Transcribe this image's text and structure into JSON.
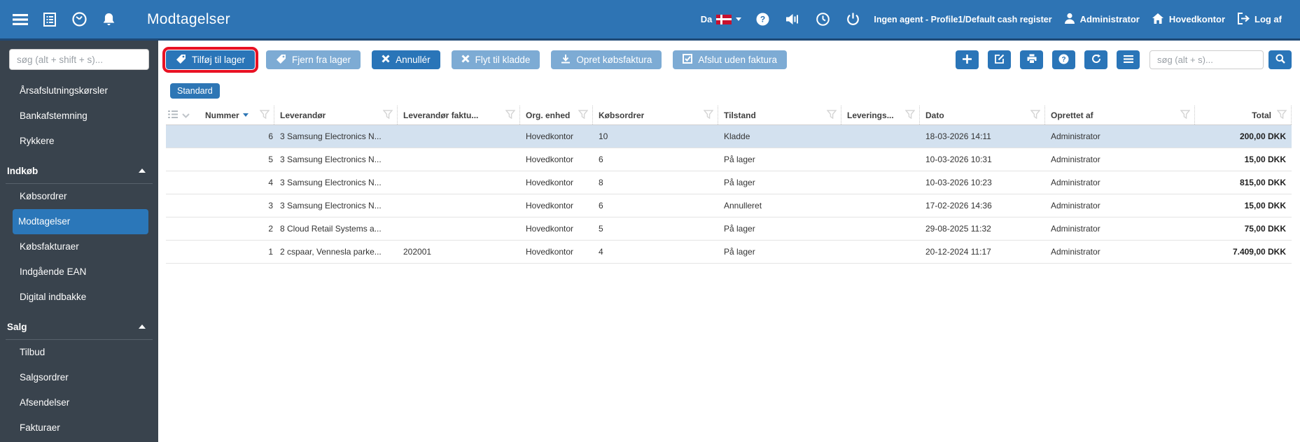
{
  "topbar": {
    "title": "Modtagelser",
    "language_label": "Da",
    "session_text": "Ingen agent - Profile1/Default cash register",
    "user": "Administrator",
    "location": "Hovedkontor",
    "logout_label": "Log af",
    "icons": [
      "menu-icon",
      "journal-icon",
      "gauge-icon",
      "bell-icon",
      "danish-flag-icon",
      "help-icon",
      "speaker-icon",
      "clock-icon",
      "power-icon",
      "user-icon",
      "home-icon",
      "logout-icon"
    ]
  },
  "sidebar": {
    "search_placeholder": "søg (alt + shift + s)...",
    "items": [
      {
        "label": "Årsafslutningskørsler",
        "type": "item",
        "active": false
      },
      {
        "label": "Bankafstemning",
        "type": "item",
        "active": false
      },
      {
        "label": "Rykkere",
        "type": "item",
        "active": false
      },
      {
        "label": "Indkøb",
        "type": "section"
      },
      {
        "label": "Købsordrer",
        "type": "item",
        "active": false
      },
      {
        "label": "Modtagelser",
        "type": "item",
        "active": true
      },
      {
        "label": "Købsfakturaer",
        "type": "item",
        "active": false
      },
      {
        "label": "Indgående EAN",
        "type": "item",
        "active": false
      },
      {
        "label": "Digital indbakke",
        "type": "item",
        "active": false
      },
      {
        "label": "Salg",
        "type": "section"
      },
      {
        "label": "Tilbud",
        "type": "item",
        "active": false
      },
      {
        "label": "Salgsordrer",
        "type": "item",
        "active": false
      },
      {
        "label": "Afsendelser",
        "type": "item",
        "active": false
      },
      {
        "label": "Fakturaer",
        "type": "item",
        "active": false
      }
    ]
  },
  "actions": {
    "buttons": [
      {
        "label": "Tilføj til lager",
        "icon": "tag-icon",
        "style": "primary",
        "annotated": true
      },
      {
        "label": "Fjern fra lager",
        "icon": "tag-icon",
        "style": "light",
        "annotated": false
      },
      {
        "label": "Annullér",
        "icon": "x-icon",
        "style": "primary",
        "annotated": false
      },
      {
        "label": "Flyt til kladde",
        "icon": "x-icon",
        "style": "light",
        "annotated": false
      },
      {
        "label": "Opret købsfaktura",
        "icon": "download-icon",
        "style": "light",
        "annotated": false
      },
      {
        "label": "Afslut uden faktura",
        "icon": "check-square-icon",
        "style": "light",
        "annotated": false
      }
    ],
    "toolbar_icons": [
      "plus-icon",
      "edit-icon",
      "print-icon",
      "help-icon",
      "refresh-icon",
      "list-icon",
      "search-icon"
    ],
    "search_placeholder": "søg (alt + s)..."
  },
  "view_tab": "Standard",
  "table": {
    "columns": [
      "Nummer",
      "Leverandør",
      "Leverandør faktu...",
      "Org. enhed",
      "Købsordrer",
      "Tilstand",
      "Leverings...",
      "Dato",
      "Oprettet af",
      "Total"
    ],
    "sort_column": "Nummer",
    "sort_direction": "desc",
    "rows": [
      {
        "selected": true,
        "nummer": "6",
        "leverandor": "3 Samsung Electronics N...",
        "faktura": "",
        "org": "Hovedkontor",
        "kobsordrer": "10",
        "tilstand": "Kladde",
        "leverings": "",
        "dato": "18-03-2026 14:11",
        "oprettet": "Administrator",
        "total": "200,00 DKK"
      },
      {
        "selected": false,
        "nummer": "5",
        "leverandor": "3 Samsung Electronics N...",
        "faktura": "",
        "org": "Hovedkontor",
        "kobsordrer": "6",
        "tilstand": "På lager",
        "leverings": "",
        "dato": "10-03-2026 10:31",
        "oprettet": "Administrator",
        "total": "15,00 DKK"
      },
      {
        "selected": false,
        "nummer": "4",
        "leverandor": "3 Samsung Electronics N...",
        "faktura": "",
        "org": "Hovedkontor",
        "kobsordrer": "8",
        "tilstand": "På lager",
        "leverings": "",
        "dato": "10-03-2026 10:23",
        "oprettet": "Administrator",
        "total": "815,00 DKK"
      },
      {
        "selected": false,
        "nummer": "3",
        "leverandor": "3 Samsung Electronics N...",
        "faktura": "",
        "org": "Hovedkontor",
        "kobsordrer": "6",
        "tilstand": "Annulleret",
        "leverings": "",
        "dato": "17-02-2026 14:36",
        "oprettet": "Administrator",
        "total": "15,00 DKK"
      },
      {
        "selected": false,
        "nummer": "2",
        "leverandor": "8 Cloud Retail Systems a...",
        "faktura": "",
        "org": "Hovedkontor",
        "kobsordrer": "5",
        "tilstand": "På lager",
        "leverings": "",
        "dato": "29-08-2025 11:32",
        "oprettet": "Administrator",
        "total": "75,00 DKK"
      },
      {
        "selected": false,
        "nummer": "1",
        "leverandor": "2 cspaar, Vennesla parke...",
        "faktura": "202001",
        "org": "Hovedkontor",
        "kobsordrer": "4",
        "tilstand": "På lager",
        "leverings": "",
        "dato": "20-12-2024 11:17",
        "oprettet": "Administrator",
        "total": "7.409,00 DKK"
      }
    ]
  },
  "colors": {
    "topbar": "#2e74b4",
    "primary_button": "#2a75b8",
    "light_button": "#7dabd4",
    "sidebar": "#39434d",
    "active_item": "#2b77b9",
    "selected_row": "#d3e1ef",
    "annotation": "#e81123"
  }
}
